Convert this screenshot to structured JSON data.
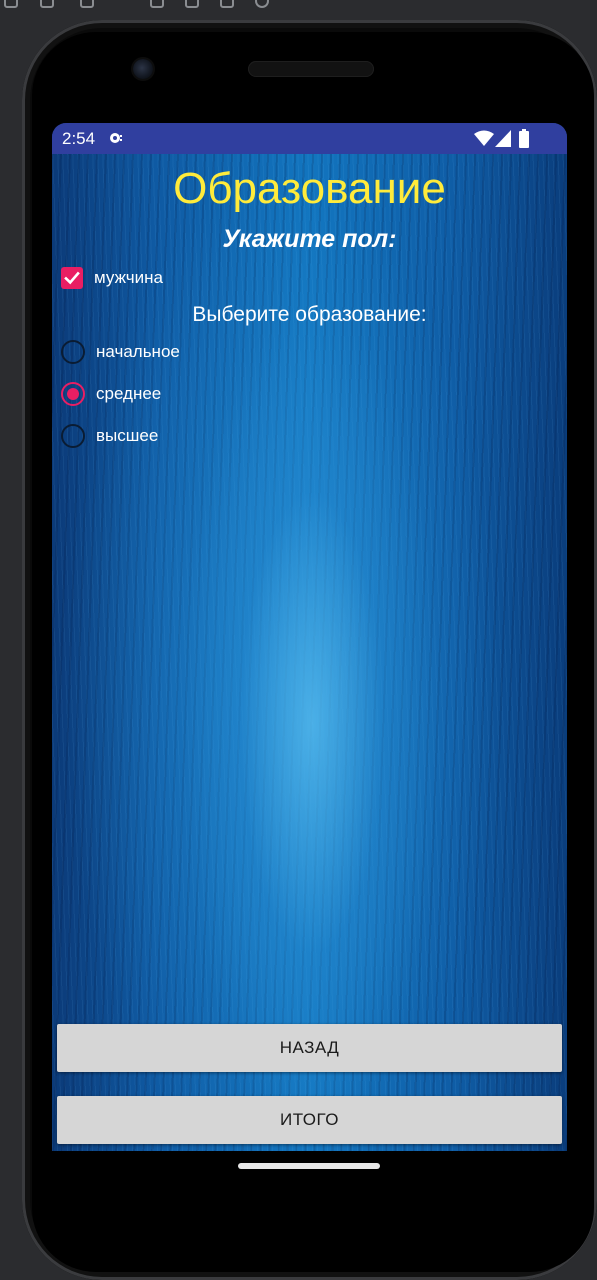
{
  "status_bar": {
    "time": "2:54",
    "icons": [
      "notification-icon",
      "wifi-icon",
      "signal-icon",
      "battery-icon"
    ]
  },
  "screen": {
    "title": "Образование",
    "gender_heading": "Укажите пол:",
    "gender_checkbox": {
      "label": "мужчина",
      "checked": true
    },
    "education_heading": "Выберите образование:",
    "education_options": [
      {
        "label": "начальное",
        "selected": false
      },
      {
        "label": "среднее",
        "selected": true
      },
      {
        "label": "высшее",
        "selected": false
      }
    ],
    "back_button": "НАЗАД",
    "total_button": "ИТОГО"
  },
  "colors": {
    "status_bar": "#303f9f",
    "title": "#ffeb3b",
    "accent": "#e91e63",
    "button_bg": "#d6d6d6",
    "background": "#1275bf"
  }
}
